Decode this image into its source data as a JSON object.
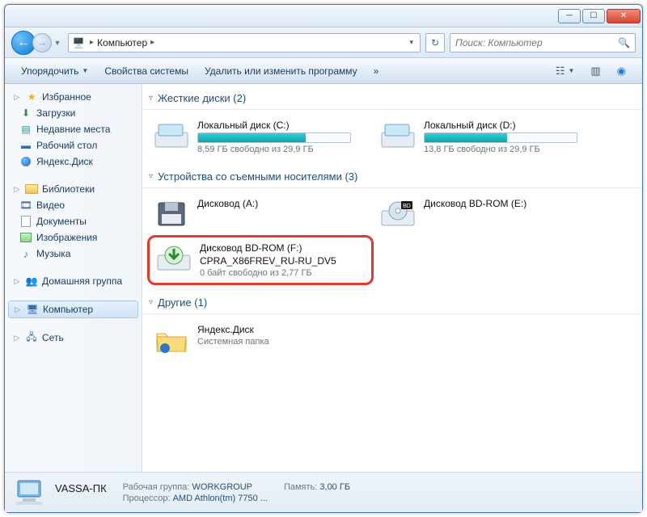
{
  "address": {
    "root": "Компьютер"
  },
  "search": {
    "placeholder": "Поиск: Компьютер"
  },
  "toolbar": {
    "organize": "Упорядочить",
    "system_props": "Свойства системы",
    "uninstall": "Удалить или изменить программу",
    "overflow": "»"
  },
  "sidebar": {
    "favorites": {
      "label": "Избранное",
      "items": [
        {
          "label": "Загрузки"
        },
        {
          "label": "Недавние места"
        },
        {
          "label": "Рабочий стол"
        },
        {
          "label": "Яндекс.Диск"
        }
      ]
    },
    "libraries": {
      "label": "Библиотеки",
      "items": [
        {
          "label": "Видео"
        },
        {
          "label": "Документы"
        },
        {
          "label": "Изображения"
        },
        {
          "label": "Музыка"
        }
      ]
    },
    "homegroup": {
      "label": "Домашняя группа"
    },
    "computer": {
      "label": "Компьютер"
    },
    "network": {
      "label": "Сеть"
    }
  },
  "groups": {
    "hdd": {
      "title": "Жесткие диски (2)",
      "items": [
        {
          "name": "Локальный диск (C:)",
          "used_pct": 71,
          "sub": "8,59 ГБ свободно из 29,9 ГБ"
        },
        {
          "name": "Локальный диск (D:)",
          "used_pct": 54,
          "sub": "13,8 ГБ свободно из 29,9 ГБ"
        }
      ]
    },
    "removable": {
      "title": "Устройства со съемными носителями (3)",
      "items": [
        {
          "name": "Дисковод (A:)"
        },
        {
          "name": "Дисковод BD-ROM (E:)"
        },
        {
          "name": "Дисковод BD-ROM (F:)",
          "sub1": "CPRA_X86FREV_RU-RU_DV5",
          "sub2": "0 байт свободно из 2,77 ГБ",
          "highlight": true
        }
      ]
    },
    "other": {
      "title": "Другие (1)",
      "items": [
        {
          "name": "Яндекс.Диск",
          "sub": "Системная папка"
        }
      ]
    }
  },
  "status": {
    "name": "VASSA-ПК",
    "workgroup_k": "Рабочая группа:",
    "workgroup_v": "WORKGROUP",
    "cpu_k": "Процессор:",
    "cpu_v": "AMD Athlon(tm) 7750 ...",
    "mem_k": "Память:",
    "mem_v": "3,00 ГБ"
  }
}
